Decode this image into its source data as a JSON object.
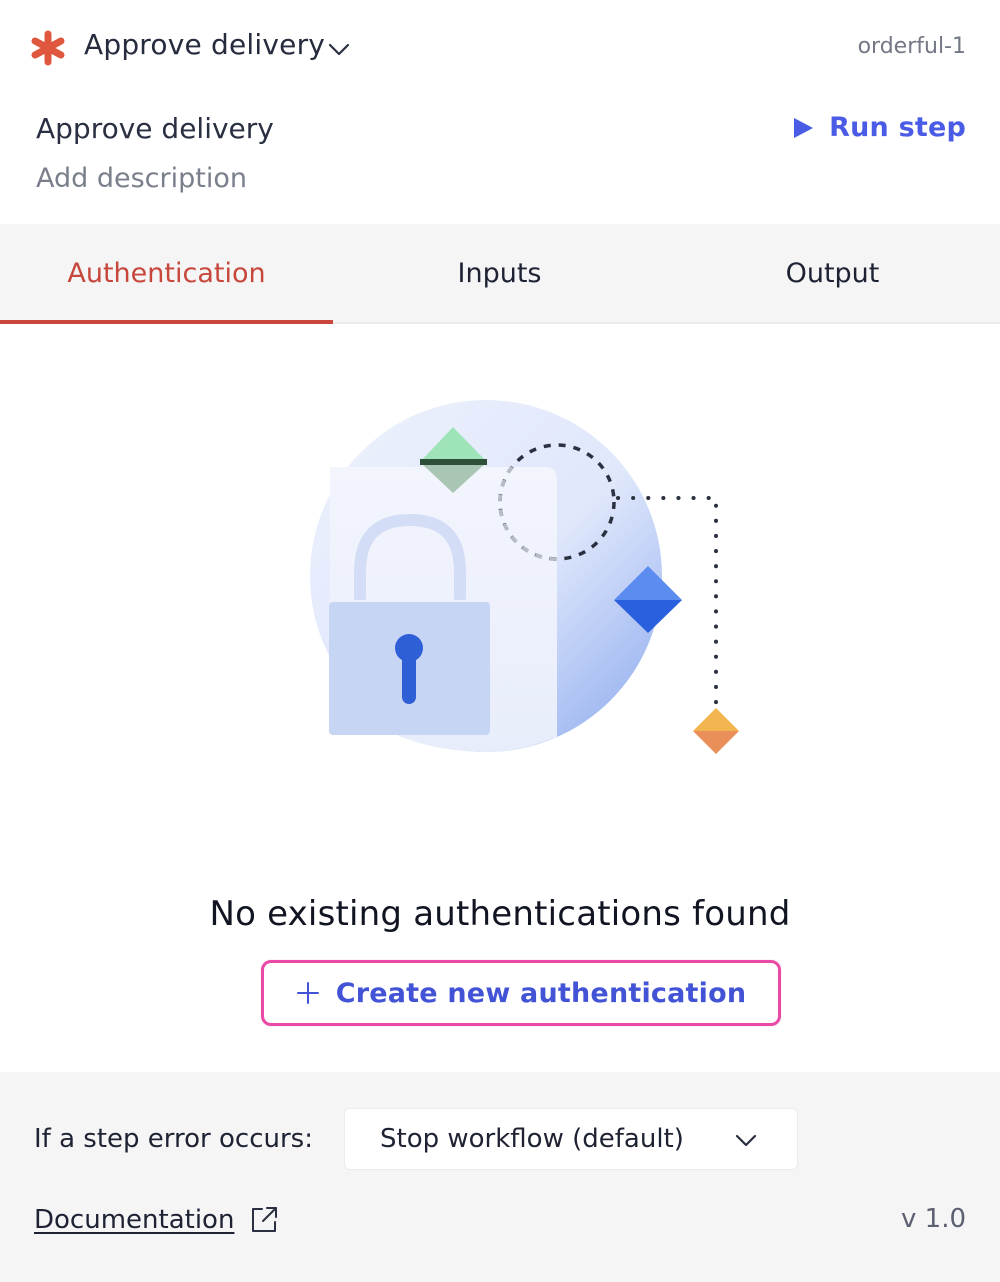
{
  "header": {
    "step_title": "Approve delivery",
    "step_id": "orderful-1",
    "icon": "asterisk-icon",
    "accent_color": "#e0573f"
  },
  "details": {
    "name": "Approve delivery",
    "description_placeholder": "Add description",
    "run_step_label": "Run step"
  },
  "tabs": [
    {
      "label": "Authentication",
      "active": true
    },
    {
      "label": "Inputs",
      "active": false
    },
    {
      "label": "Output",
      "active": false
    }
  ],
  "empty_state": {
    "message": "No existing authentications found",
    "create_button_label": "Create new authentication"
  },
  "footer": {
    "error_label": "If a step error occurs:",
    "error_select_value": "Stop workflow (default)",
    "documentation_label": "Documentation",
    "version": "v 1.0"
  },
  "colors": {
    "active_tab": "#c7473c",
    "link": "#4a5be6",
    "focus_outline": "#ea4aa6"
  }
}
